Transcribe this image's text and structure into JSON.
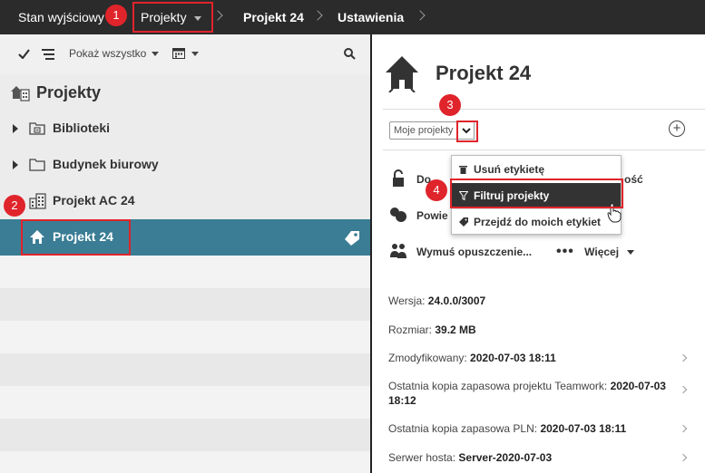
{
  "breadcrumb": {
    "root": "Stan wyjściowy",
    "projects": "Projekty",
    "project": "Projekt 24",
    "settings": "Ustawienia"
  },
  "callouts": [
    "1",
    "2",
    "3",
    "4"
  ],
  "left_toolbar": {
    "show_all": "Pokaż wszystko"
  },
  "tree": {
    "title": "Projekty",
    "items": [
      {
        "label": "Biblioteki",
        "icon": "library-folder-icon",
        "expandable": true
      },
      {
        "label": "Budynek biurowy",
        "icon": "folder-icon",
        "expandable": true
      },
      {
        "label": "Projekt AC 24",
        "icon": "building-icon",
        "expandable": false
      },
      {
        "label": "Projekt 24",
        "icon": "house-icon",
        "expandable": false,
        "selected": true
      }
    ]
  },
  "detail": {
    "title": "Projekt 24",
    "tag_filter_value": "Moje projekty",
    "actions": {
      "access": "Do",
      "access_suffix": "ość",
      "power": "Powie",
      "force_leave": "Wymuś opuszczenie...",
      "more": "Więcej"
    },
    "info": [
      {
        "label": "Wersja:",
        "value": "24.0.0/3007",
        "chevron": false
      },
      {
        "label": "Rozmiar:",
        "value": "39.2 MB",
        "chevron": false
      },
      {
        "label": "Zmodyfikowany:",
        "value": "2020-07-03 18:11",
        "chevron": true
      },
      {
        "label": "Ostatnia kopia zapasowa projektu Teamwork:",
        "value": "2020-07-03",
        "value2": "18:12",
        "chevron": true
      },
      {
        "label": "Ostatnia kopia zapasowa PLN:",
        "value": "2020-07-03 18:11",
        "chevron": true
      },
      {
        "label": "Serwer hosta:",
        "value": "Server-2020-07-03",
        "chevron": true
      }
    ]
  },
  "menu": {
    "items": [
      {
        "label": "Usuń etykietę",
        "icon": "trash-icon"
      },
      {
        "label": "Filtruj projekty",
        "icon": "filter-icon",
        "active": true
      },
      {
        "label": "Przejdź do moich etykiet",
        "icon": "tag-icon"
      }
    ]
  },
  "colors": {
    "topbar": "#2b2b2b",
    "selected_row": "#3a7d95",
    "callout": "#e0242b",
    "menu_active": "#333333"
  }
}
